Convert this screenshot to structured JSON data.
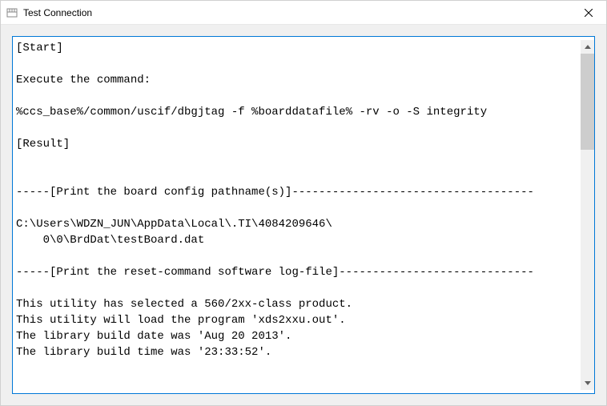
{
  "window": {
    "title": "Test Connection"
  },
  "console": {
    "lines": [
      "[Start]",
      "",
      "Execute the command:",
      "",
      "%ccs_base%/common/uscif/dbgjtag -f %boarddatafile% -rv -o -S integrity",
      "",
      "[Result]",
      "",
      "",
      "-----[Print the board config pathname(s)]------------------------------------",
      "",
      "C:\\Users\\WDZN_JUN\\AppData\\Local\\.TI\\4084209646\\",
      "    0\\0\\BrdDat\\testBoard.dat",
      "",
      "-----[Print the reset-command software log-file]-----------------------------",
      "",
      "This utility has selected a 560/2xx-class product.",
      "This utility will load the program 'xds2xxu.out'.",
      "The library build date was 'Aug 20 2013'.",
      "The library build time was '23:33:52'."
    ]
  }
}
